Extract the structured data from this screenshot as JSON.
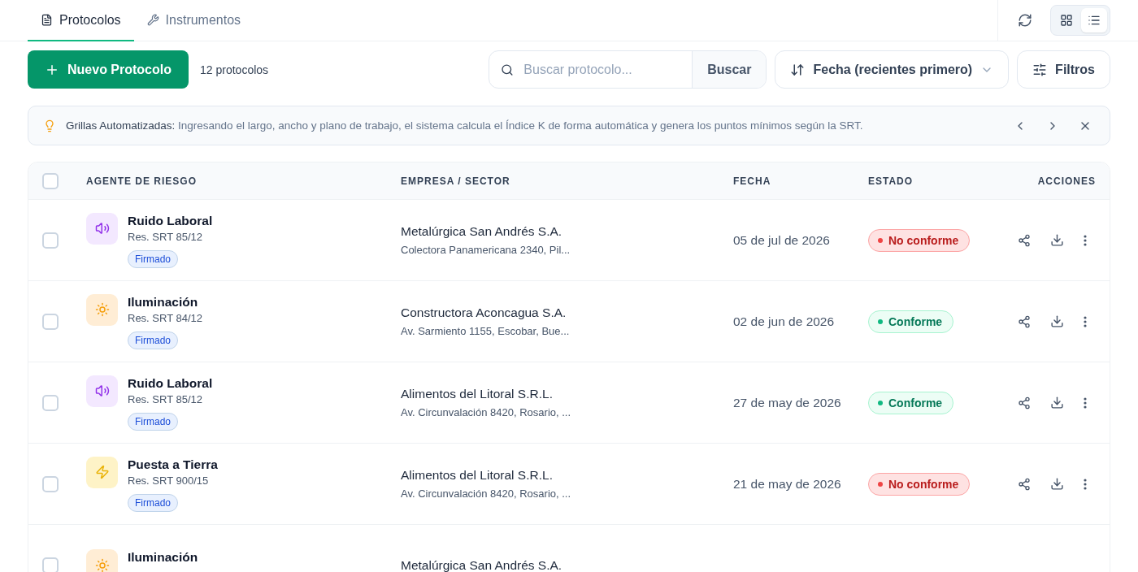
{
  "tabs": [
    {
      "label": "Protocolos",
      "kind": "document",
      "selected": true
    },
    {
      "label": "Instrumentos",
      "kind": "wrench",
      "selected": false
    }
  ],
  "views": [
    {
      "kind": "grid",
      "selected": false
    },
    {
      "kind": "list",
      "selected": true
    }
  ],
  "toolbar": {
    "new_button": "Nuevo Protocolo",
    "count": "12 protocolos",
    "search": {
      "placeholder": "Buscar protocolo...",
      "button": "Buscar"
    },
    "sort": "Fecha (recientes primero)",
    "filters": "Filtros"
  },
  "tip": {
    "title": "Grillas Automatizadas:",
    "text": "Ingresando el largo, ancho y plano de trabajo, el sistema calcula el Índice K de forma automática y genera los puntos mínimos según la SRT."
  },
  "table": {
    "columns": [
      "AGENTE DE RIESGO",
      "EMPRESA / SECTOR",
      "FECHA",
      "ESTADO",
      "ACCIONES"
    ],
    "all_checked": false,
    "rows": [
      {
        "checked": false,
        "agent": {
          "kind": "sound",
          "name": "Ruido Laboral",
          "regulation": "Res. SRT 85/12",
          "tag": "Firmado"
        },
        "company": "Metalúrgica San Andrés S.A.",
        "address": "Colectora Panamericana 2340, Pil...",
        "date": "05 de jul de 2026",
        "status": {
          "kind": "fail",
          "label": "No conforme"
        }
      },
      {
        "checked": false,
        "agent": {
          "kind": "sun",
          "name": "Iluminación",
          "regulation": "Res. SRT 84/12",
          "tag": "Firmado"
        },
        "company": "Constructora Aconcagua S.A.",
        "address": "Av. Sarmiento 1155, Escobar, Bue...",
        "date": "02 de jun de 2026",
        "status": {
          "kind": "ok",
          "label": "Conforme"
        }
      },
      {
        "checked": false,
        "agent": {
          "kind": "sound",
          "name": "Ruido Laboral",
          "regulation": "Res. SRT 85/12",
          "tag": "Firmado"
        },
        "company": "Alimentos del Litoral S.R.L.",
        "address": "Av. Circunvalación 8420, Rosario, ...",
        "date": "27 de may de 2026",
        "status": {
          "kind": "ok",
          "label": "Conforme"
        }
      },
      {
        "checked": false,
        "agent": {
          "kind": "bolt",
          "name": "Puesta a Tierra",
          "regulation": "Res. SRT 900/15",
          "tag": "Firmado"
        },
        "company": "Alimentos del Litoral S.R.L.",
        "address": "Av. Circunvalación 8420, Rosario, ...",
        "date": "21 de may de 2026",
        "status": {
          "kind": "fail",
          "label": "No conforme"
        }
      },
      {
        "checked": false,
        "agent": {
          "kind": "sun",
          "name": "Iluminación"
        },
        "company": "Metalúrgica San Andrés S.A."
      }
    ]
  }
}
